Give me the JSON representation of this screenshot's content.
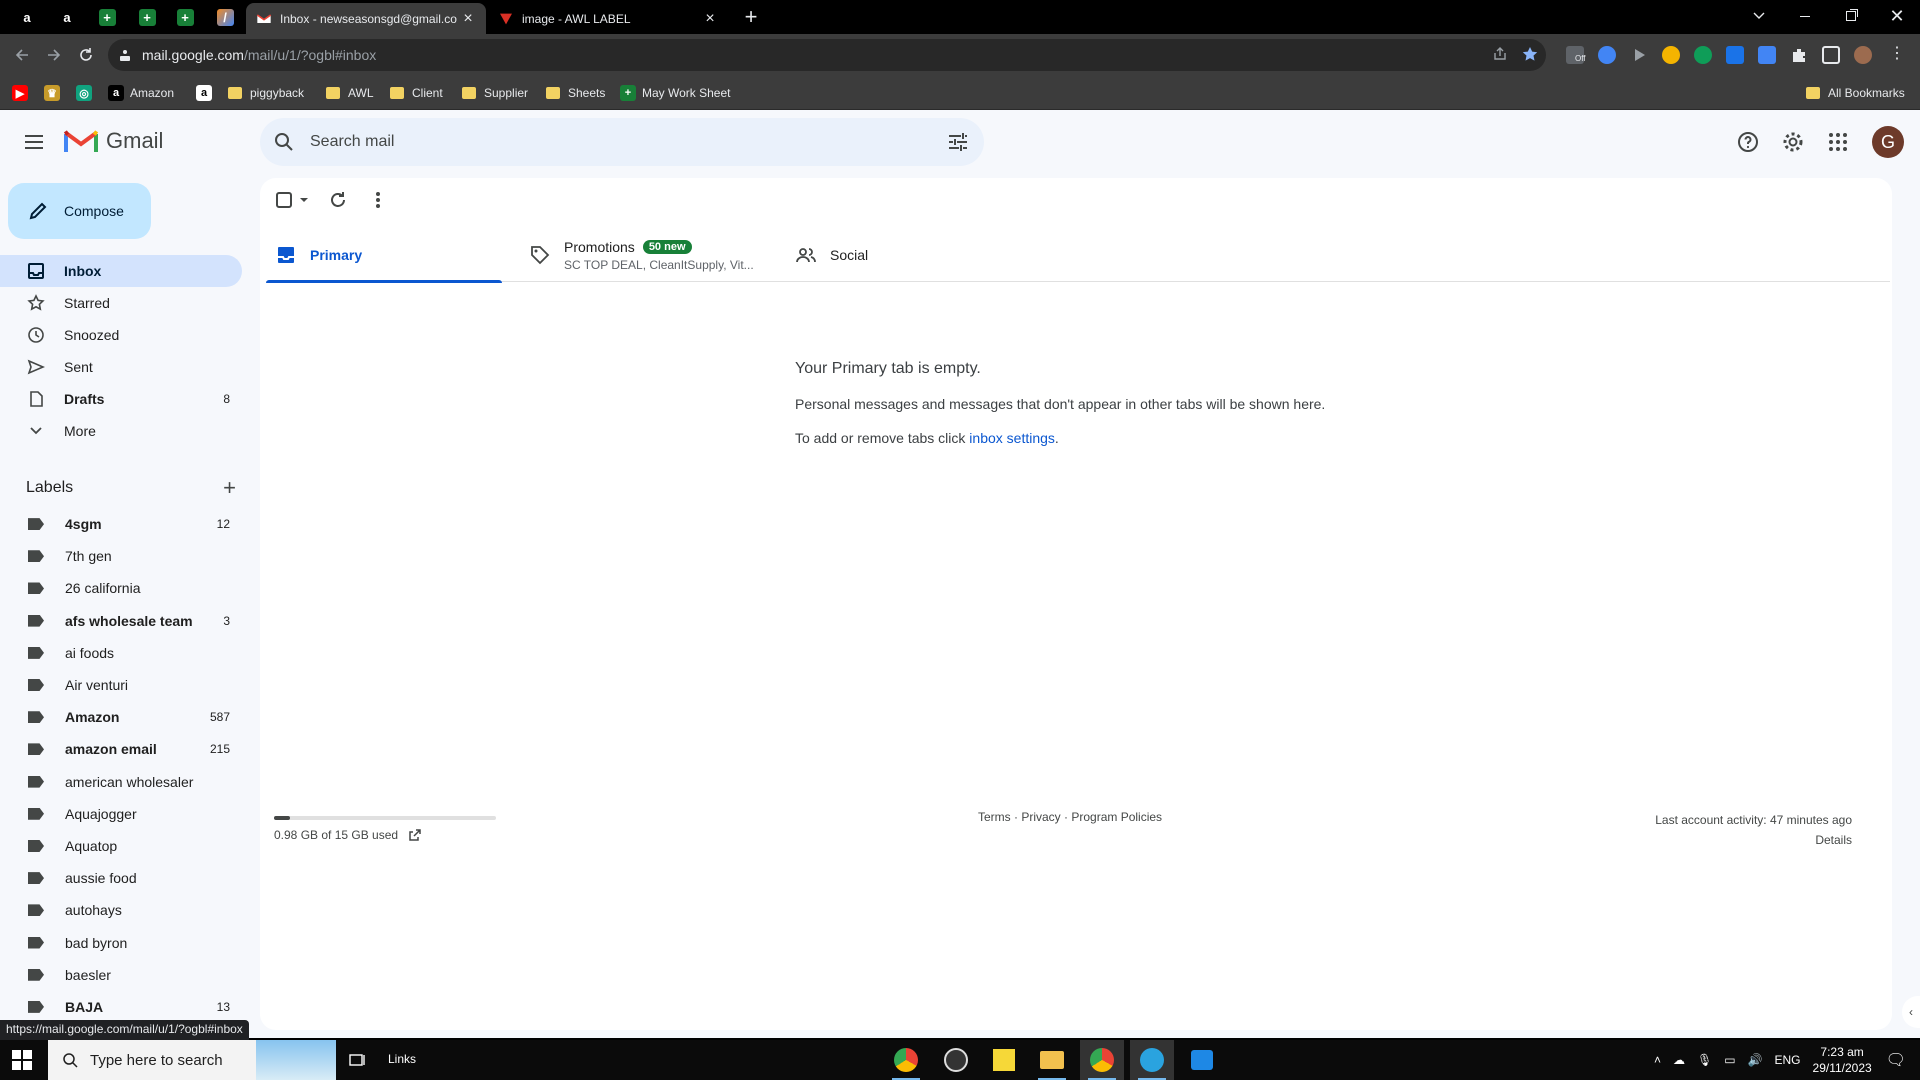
{
  "browser": {
    "tabs": [
      {
        "title": "Inbox - newseasonsgd@gmail.co",
        "active": true
      },
      {
        "title": "image - AWL LABEL",
        "active": false
      }
    ],
    "url_main": "mail.google.com",
    "url_rest": "/mail/u/1/?ogbl#inbox",
    "bookmarks": [
      "Amazon",
      "piggyback",
      "AWL",
      "Client",
      "Supplier",
      "Sheets",
      "May Work Sheet"
    ],
    "all_bookmarks": "All Bookmarks",
    "ext_off_label": "Off",
    "status_url": "https://mail.google.com/mail/u/1/?ogbl#inbox"
  },
  "gmail": {
    "brand": "Gmail",
    "search_placeholder": "Search mail",
    "avatar_letter": "G",
    "compose_label": "Compose",
    "nav": [
      {
        "label": "Inbox",
        "count": "",
        "icon": "inbox-icon"
      },
      {
        "label": "Starred",
        "count": "",
        "icon": "star-icon"
      },
      {
        "label": "Snoozed",
        "count": "",
        "icon": "clock-icon"
      },
      {
        "label": "Sent",
        "count": "",
        "icon": "send-icon"
      },
      {
        "label": "Drafts",
        "count": "8",
        "icon": "draft-icon"
      },
      {
        "label": "More",
        "count": "",
        "icon": "chevron-down-icon"
      }
    ],
    "labels_title": "Labels",
    "labels": [
      {
        "label": "4sgm",
        "count": "12",
        "bold": true
      },
      {
        "label": "7th gen",
        "count": "",
        "bold": false
      },
      {
        "label": "26 california",
        "count": "",
        "bold": false
      },
      {
        "label": "afs wholesale team",
        "count": "3",
        "bold": true
      },
      {
        "label": "ai foods",
        "count": "",
        "bold": false
      },
      {
        "label": "Air venturi",
        "count": "",
        "bold": false
      },
      {
        "label": "Amazon",
        "count": "587",
        "bold": true
      },
      {
        "label": "amazon email",
        "count": "215",
        "bold": true
      },
      {
        "label": "american wholesaler",
        "count": "",
        "bold": false
      },
      {
        "label": "Aquajogger",
        "count": "",
        "bold": false
      },
      {
        "label": "Aquatop",
        "count": "",
        "bold": false
      },
      {
        "label": "aussie food",
        "count": "",
        "bold": false
      },
      {
        "label": "autohays",
        "count": "",
        "bold": false
      },
      {
        "label": "bad byron",
        "count": "",
        "bold": false
      },
      {
        "label": "baesler",
        "count": "",
        "bold": false
      },
      {
        "label": "BAJA",
        "count": "13",
        "bold": true
      }
    ],
    "tabs": {
      "primary": "Primary",
      "promotions": "Promotions",
      "promotions_badge": "50 new",
      "promotions_sub": "SC TOP DEAL, CleanItSupply, Vit...",
      "social": "Social"
    },
    "empty": {
      "title": "Your Primary tab is empty.",
      "line1": "Personal messages and messages that don't appear in other tabs will be shown here.",
      "line2_prefix": "To add or remove tabs click ",
      "line2_link": "inbox settings",
      "line2_suffix": "."
    },
    "footer": {
      "storage": "0.98 GB of 15 GB used",
      "storage_fraction": 0.065,
      "terms": "Terms",
      "privacy": "Privacy",
      "policies": "Program Policies",
      "separator": " · ",
      "activity": "Last account activity: 47 minutes ago",
      "details": "Details"
    }
  },
  "taskbar": {
    "search_placeholder": "Type here to search",
    "links": "Links",
    "lang": "ENG",
    "time": "7:23 am",
    "date": "29/11/2023"
  },
  "colors": {
    "accent": "#0b57d0",
    "compose_bg": "#c2e7ff",
    "nav_active": "#d3e3fd",
    "badge_green": "#188038"
  }
}
